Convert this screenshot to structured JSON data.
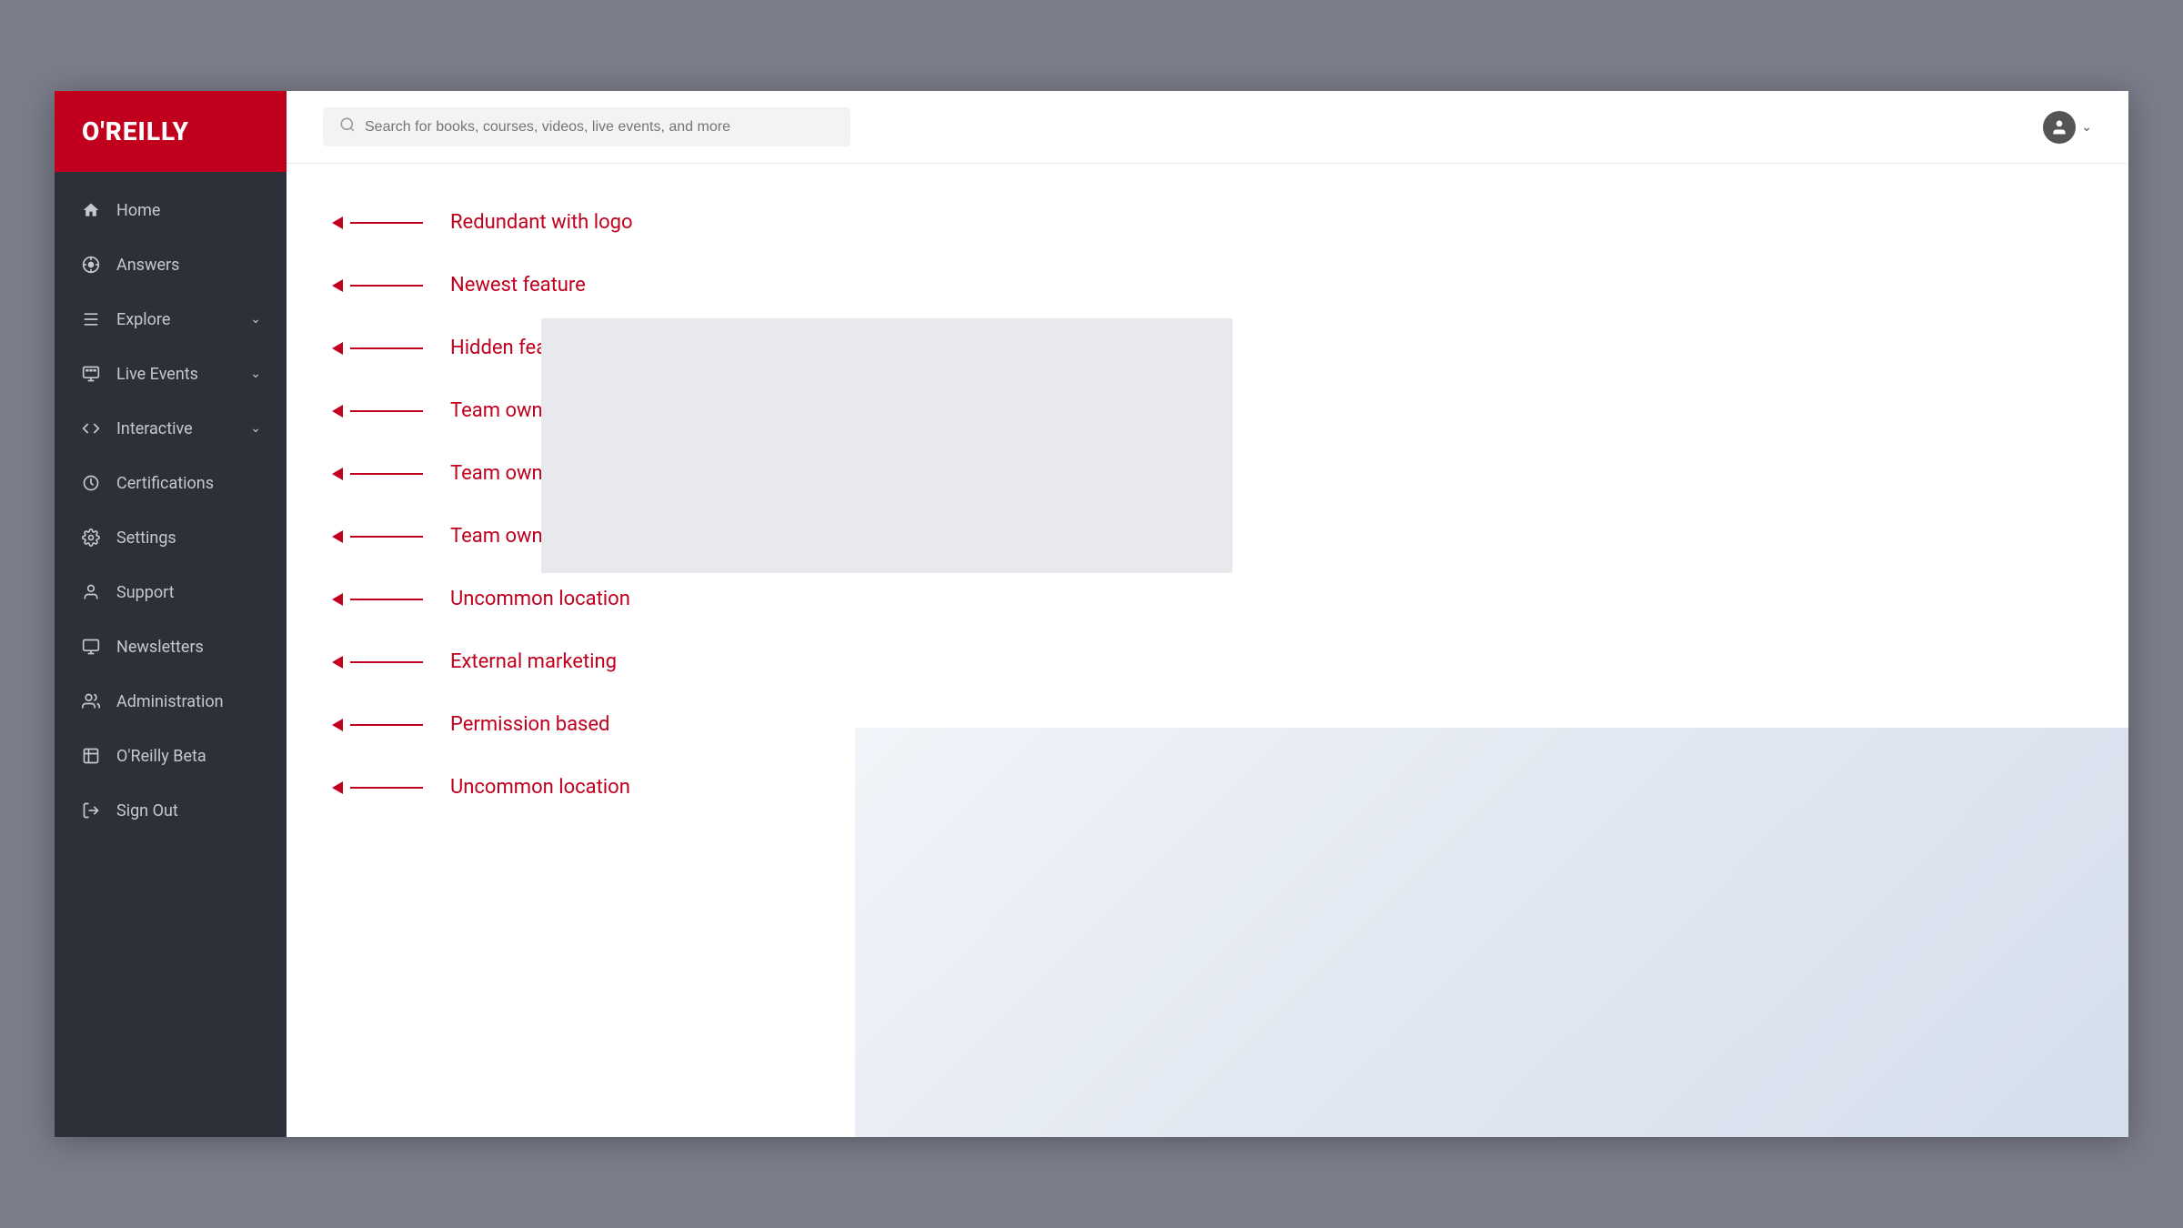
{
  "app": {
    "logo": "O'REILLY"
  },
  "header": {
    "search_placeholder": "Search for books, courses, videos, live events, and more"
  },
  "sidebar": {
    "items": [
      {
        "id": "home",
        "label": "Home",
        "icon": "🏠",
        "has_chevron": false
      },
      {
        "id": "answers",
        "label": "Answers",
        "icon": "⚙",
        "has_chevron": false
      },
      {
        "id": "explore",
        "label": "Explore",
        "icon": "☰",
        "has_chevron": true
      },
      {
        "id": "live-events",
        "label": "Live Events",
        "icon": "▦",
        "has_chevron": true
      },
      {
        "id": "interactive",
        "label": "Interactive",
        "icon": "</>",
        "has_chevron": true
      },
      {
        "id": "certifications",
        "label": "Certifications",
        "icon": "⚙",
        "has_chevron": false
      },
      {
        "id": "settings",
        "label": "Settings",
        "icon": "⚙",
        "has_chevron": false
      },
      {
        "id": "support",
        "label": "Support",
        "icon": "👤",
        "has_chevron": false
      },
      {
        "id": "newsletters",
        "label": "Newsletters",
        "icon": "📋",
        "has_chevron": false
      },
      {
        "id": "administration",
        "label": "Administration",
        "icon": "👥",
        "has_chevron": false
      },
      {
        "id": "oreilly-beta",
        "label": "O'Reilly Beta",
        "icon": "🔬",
        "has_chevron": false
      },
      {
        "id": "sign-out",
        "label": "Sign Out",
        "icon": "→",
        "has_chevron": false
      }
    ]
  },
  "content": {
    "rows": [
      {
        "id": "row-1",
        "label": "Redundant with logo"
      },
      {
        "id": "row-2",
        "label": "Newest feature"
      },
      {
        "id": "row-3",
        "label": "Hidden features, like Topics"
      },
      {
        "id": "row-4",
        "label": "Team owned feature"
      },
      {
        "id": "row-5",
        "label": "Team owned feature"
      },
      {
        "id": "row-6",
        "label": "Team owned feature"
      },
      {
        "id": "row-7",
        "label": "Uncommon location"
      },
      {
        "id": "row-8",
        "label": "External marketing"
      },
      {
        "id": "row-9",
        "label": "Permission based"
      },
      {
        "id": "row-10",
        "label": "Uncommon location"
      }
    ]
  }
}
